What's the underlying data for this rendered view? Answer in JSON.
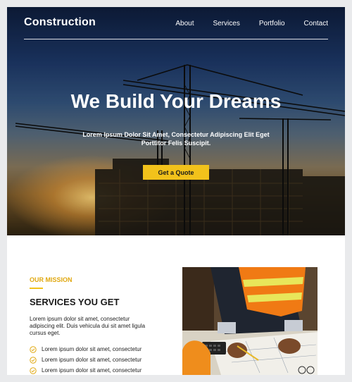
{
  "nav": {
    "brand": "Construction",
    "items": [
      {
        "label": "About"
      },
      {
        "label": "Services"
      },
      {
        "label": "Portfolio"
      },
      {
        "label": "Contact"
      }
    ]
  },
  "hero": {
    "title": "We Build Your Dreams",
    "subtitle": "Lorem Ipsum Dolor Sit Amet, Consectetur Adipiscing Elit Eget Porttitor Felis Suscipit.",
    "cta_label": "Get a Quote"
  },
  "mission": {
    "eyebrow": "OUR MISSION",
    "title": "SERVICES YOU GET",
    "description": "Lorem ipsum dolor sit amet, consectetur adipiscing elit. Duis vehicula dui sit amet ligula cursus eget.",
    "checklist": [
      {
        "text": "Lorem ipsum dolor sit amet, consectetur"
      },
      {
        "text": "Lorem ipsum dolor sit amet, consectetur"
      },
      {
        "text": "Lorem ipsum dolor sit amet, consectetur"
      }
    ]
  },
  "colors": {
    "accent": "#f2c21b",
    "eyebrow": "#e0a810",
    "page_bg": "#e9eaec"
  },
  "icons": {
    "check": "check-circle-icon"
  }
}
